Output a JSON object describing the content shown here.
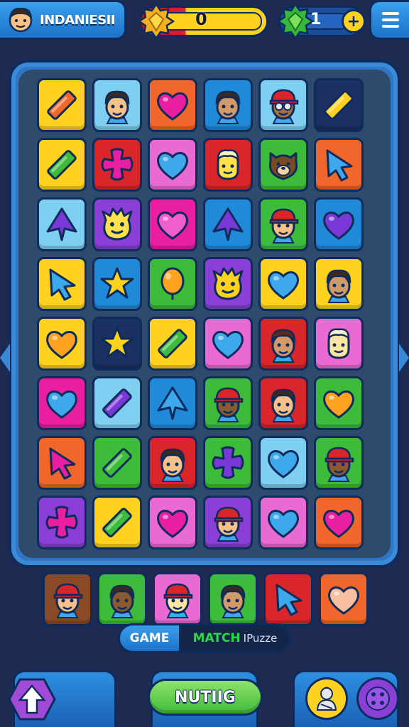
{
  "player": {
    "name": "INDANIESII",
    "avatar_icon": "boy-avatar-icon"
  },
  "hud": {
    "score_value": "0",
    "score_fill_fraction": 0.05,
    "lives_value": "1",
    "plus_label": "+",
    "score_icon": "gold-gem-badge-icon",
    "lives_icon": "green-gem-badge-icon",
    "menu_icon": "hamburger-menu-icon"
  },
  "board": {
    "rows": [
      [
        {
          "bg": "#ffd21f",
          "icon": "bar",
          "color": "#f0662b"
        },
        {
          "bg": "#7fd0f0",
          "icon": "face",
          "color": "#f6c089",
          "hair": "#3a2a20",
          "hat": ""
        },
        {
          "bg": "#f0662b",
          "icon": "heart",
          "color": "#e91ea1"
        },
        {
          "bg": "#1f8ad8",
          "icon": "face",
          "color": "#d29a6b",
          "hair": "#3a2a20",
          "hat": ""
        },
        {
          "bg": "#7fd0f0",
          "icon": "face",
          "color": "#a9703e",
          "hair": "#3a2a20",
          "hat": "#d8262b",
          "glasses": true
        },
        {
          "bg": "#1b3162",
          "icon": "bar",
          "color": "#ffd21f"
        }
      ],
      [
        {
          "bg": "#ffd21f",
          "icon": "bar",
          "color": "#3dbb3a"
        },
        {
          "bg": "#d8262b",
          "icon": "cross",
          "color": "#e91ea1"
        },
        {
          "bg": "#e86ad2",
          "icon": "heart",
          "color": "#3ea8ec"
        },
        {
          "bg": "#d8262b",
          "icon": "blob",
          "color": "#ffe24a",
          "hat": "#fff2c4"
        },
        {
          "bg": "#3dbb3a",
          "icon": "bear",
          "color": "#7a4a26"
        },
        {
          "bg": "#f0662b",
          "icon": "arrow",
          "color": "#3ea8ec"
        }
      ],
      [
        {
          "bg": "#7fd0f0",
          "icon": "spade",
          "color": "#7a38d8"
        },
        {
          "bg": "#8a40d6",
          "icon": "monster",
          "color": "#ffe24a"
        },
        {
          "bg": "#e91ea1",
          "icon": "heart",
          "color": "#f25fcd"
        },
        {
          "bg": "#1f8ad8",
          "icon": "spade",
          "color": "#7a38d8"
        },
        {
          "bg": "#3dbb3a",
          "icon": "face",
          "color": "#f6c089",
          "hair": "#3a2a20",
          "hat": "#d8262b"
        },
        {
          "bg": "#1f8ad8",
          "icon": "heart",
          "color": "#7a38d8"
        }
      ],
      [
        {
          "bg": "#ffd21f",
          "icon": "arrow",
          "color": "#3ea8ec"
        },
        {
          "bg": "#1f8ad8",
          "icon": "star",
          "color": "#ffd21f"
        },
        {
          "bg": "#3dbb3a",
          "icon": "balloon",
          "color": "#ffa21f"
        },
        {
          "bg": "#8a40d6",
          "icon": "monster",
          "color": "#ffd21f"
        },
        {
          "bg": "#ffd21f",
          "icon": "heart",
          "color": "#3ea8ec"
        },
        {
          "bg": "#ffd21f",
          "icon": "face",
          "color": "#d29a6b",
          "hair": "#3a2a20",
          "hat": ""
        }
      ],
      [
        {
          "bg": "#ffd21f",
          "icon": "heart",
          "color": "#ffa21f"
        },
        {
          "bg": "#1b3162",
          "icon": "star",
          "color": "#ffd21f"
        },
        {
          "bg": "#ffd21f",
          "icon": "bar",
          "color": "#3dbb3a"
        },
        {
          "bg": "#e86ad2",
          "icon": "heart",
          "color": "#3ea8ec"
        },
        {
          "bg": "#d8262b",
          "icon": "face",
          "color": "#d29a6b",
          "hair": "#5a2a20",
          "hat": ""
        },
        {
          "bg": "#e86ad2",
          "icon": "blob",
          "color": "#ffe6a0",
          "hat": "#fff2c4"
        }
      ],
      [
        {
          "bg": "#e91ea1",
          "icon": "heart",
          "color": "#3ea8ec"
        },
        {
          "bg": "#7fd0f0",
          "icon": "bar",
          "color": "#7a38d8"
        },
        {
          "bg": "#1f8ad8",
          "icon": "spade",
          "color": "#3ea8ec"
        },
        {
          "bg": "#3dbb3a",
          "icon": "face",
          "color": "#8a5a30",
          "hair": "#3a2a20",
          "hat": "#d8262b"
        },
        {
          "bg": "#d8262b",
          "icon": "face",
          "color": "#f6c089",
          "hair": "#3a2a20",
          "hat": ""
        },
        {
          "bg": "#3dbb3a",
          "icon": "heart",
          "color": "#ffa21f"
        }
      ],
      [
        {
          "bg": "#f0662b",
          "icon": "arrow",
          "color": "#e91ea1"
        },
        {
          "bg": "#3dbb3a",
          "icon": "bar",
          "color": "#3dbb3a"
        },
        {
          "bg": "#d8262b",
          "icon": "face",
          "color": "#f6c089",
          "hair": "#3a2a20",
          "hat": ""
        },
        {
          "bg": "#3dbb3a",
          "icon": "cross",
          "color": "#7a38d8"
        },
        {
          "bg": "#7fd0f0",
          "icon": "heart",
          "color": "#3ea8ec"
        },
        {
          "bg": "#3dbb3a",
          "icon": "face",
          "color": "#8a5a30",
          "hair": "#3a2a20",
          "hat": "#d8262b"
        }
      ],
      [
        {
          "bg": "#8a40d6",
          "icon": "cross",
          "color": "#e91ea1"
        },
        {
          "bg": "#ffd21f",
          "icon": "bar",
          "color": "#3dbb3a"
        },
        {
          "bg": "#e86ad2",
          "icon": "heart",
          "color": "#e91ea1"
        },
        {
          "bg": "#8a40d6",
          "icon": "face",
          "color": "#f6c089",
          "hair": "#3a2a20",
          "hat": "#d8262b"
        },
        {
          "bg": "#e86ad2",
          "icon": "heart",
          "color": "#3ea8ec"
        },
        {
          "bg": "#f0662b",
          "icon": "heart",
          "color": "#e91ea1"
        }
      ]
    ]
  },
  "queue": [
    {
      "bg": "#8a4a26",
      "icon": "face",
      "color": "#f6c089",
      "hair": "#3a2a20",
      "hat": "#d8262b"
    },
    {
      "bg": "#3dbb3a",
      "icon": "face",
      "color": "#8a5a30",
      "hair": "#3a2a20",
      "hat": ""
    },
    {
      "bg": "#e86ad2",
      "icon": "face",
      "color": "#ffe6a0",
      "hair": "#3a2a20",
      "hat": "#d8262b"
    },
    {
      "bg": "#3dbb3a",
      "icon": "face",
      "color": "#d29a6b",
      "hair": "#3a2a20",
      "hat": ""
    },
    {
      "bg": "#d8262b",
      "icon": "arrow",
      "color": "#3ea8ec"
    },
    {
      "bg": "#f0662b",
      "icon": "heart",
      "color": "#f6c0a0"
    }
  ],
  "mode": {
    "game": "GAME",
    "match": "MATCH",
    "puzzle": "IPuzze"
  },
  "footer": {
    "main_button": "NUTIIG",
    "up_icon": "up-arrow-icon",
    "hero_icon": "hero-portrait-icon",
    "settings_icon": "button-dots-icon"
  }
}
